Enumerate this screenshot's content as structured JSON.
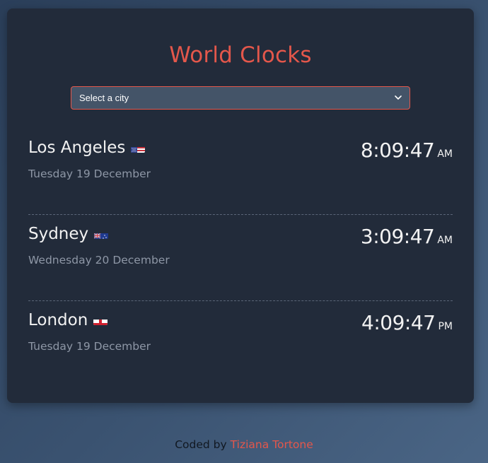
{
  "app": {
    "title": "World Clocks"
  },
  "city_select": {
    "selected": "Select a city"
  },
  "clocks": [
    {
      "city": "Los Angeles",
      "flag": "flag-us-icon",
      "date": "Tuesday 19 December",
      "time": "8:09:47",
      "period": "AM"
    },
    {
      "city": "Sydney",
      "flag": "flag-au-icon",
      "date": "Wednesday 20 December",
      "time": "3:09:47",
      "period": "AM"
    },
    {
      "city": "London",
      "flag": "flag-england-icon",
      "date": "Tuesday 19 December",
      "time": "4:09:47",
      "period": "PM"
    }
  ],
  "footer": {
    "prefix": "Coded by",
    "author": "Tiziana Tortone"
  },
  "colors": {
    "accent": "#e4574b",
    "card": "#222b3a",
    "text": "#f2f2f2",
    "muted": "#8e97a6"
  }
}
